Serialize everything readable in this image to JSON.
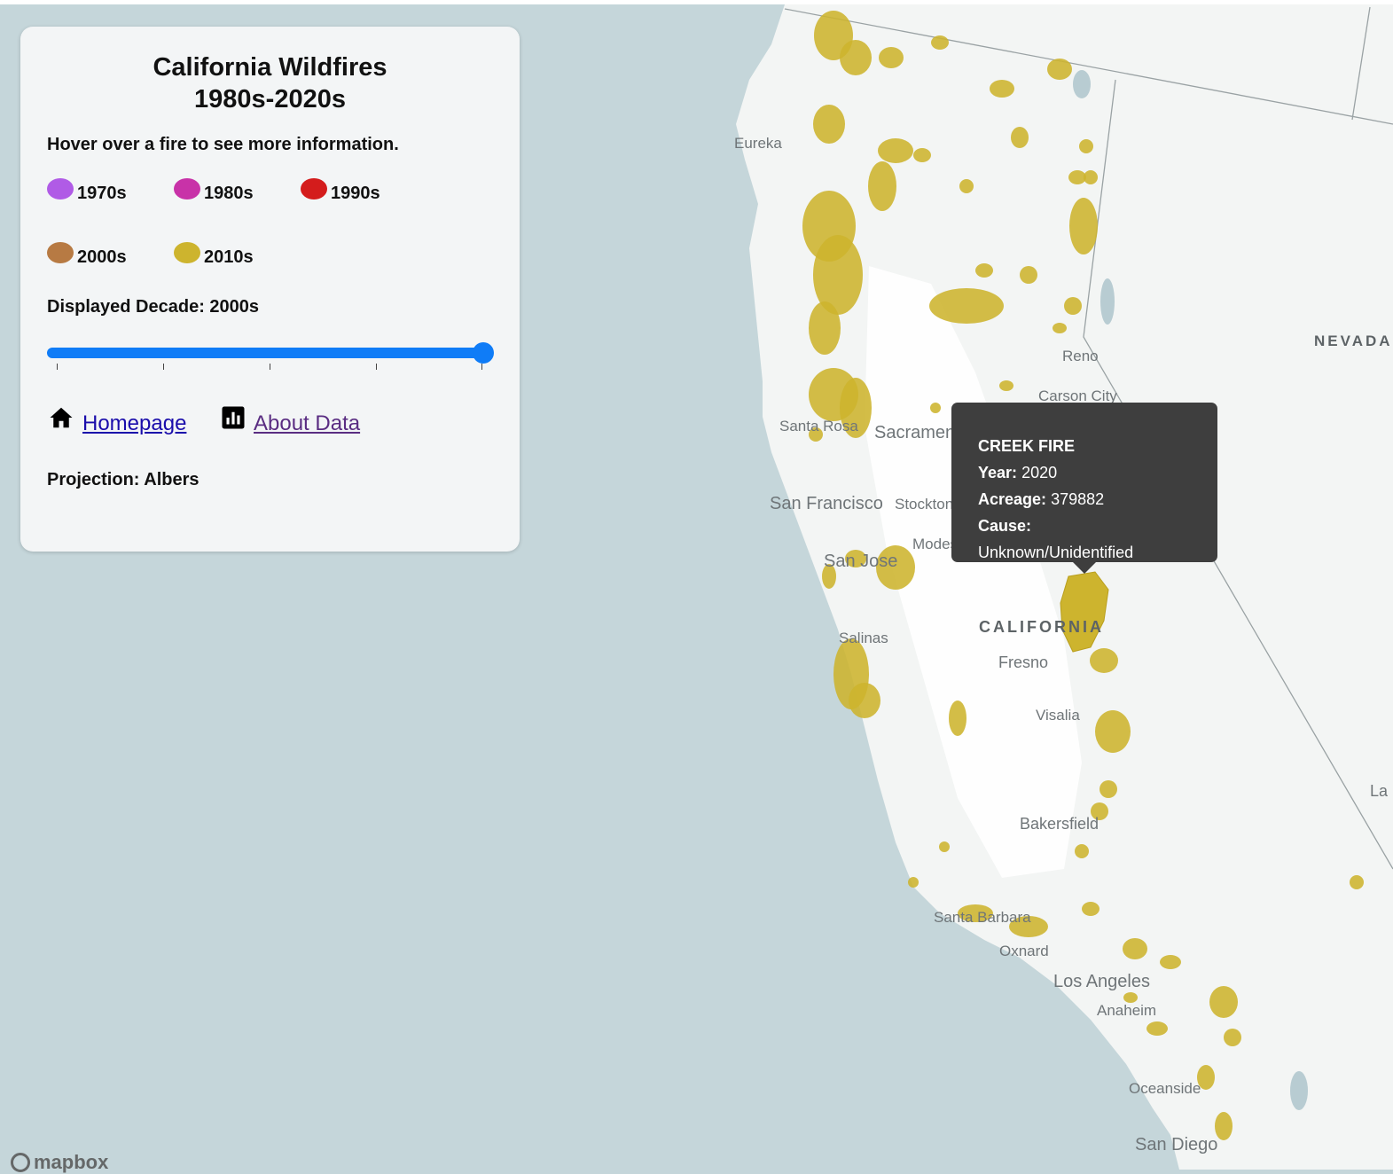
{
  "panel": {
    "title_line1": "California Wildfires",
    "title_line2": "1980s-2020s",
    "instruction": "Hover over a fire to see more information.",
    "legend": [
      {
        "label": "1970s",
        "color": "#b05be6"
      },
      {
        "label": "1980s",
        "color": "#c832a8"
      },
      {
        "label": "1990s",
        "color": "#d41c1c"
      },
      {
        "label": "2000s",
        "color": "#b77a43"
      },
      {
        "label": "2010s",
        "color": "#cdb42e"
      }
    ],
    "displayed_decade": "Displayed Decade: 2000s",
    "slider": {
      "ticks": 5,
      "value_fraction": 1.0
    },
    "links": {
      "homepage": "Homepage",
      "about": "About Data"
    },
    "projection": "Projection: Albers"
  },
  "tooltip": {
    "name": "CREEK FIRE",
    "year_label": "Year:",
    "year": "2020",
    "acreage_label": "Acreage:",
    "acreage": "379882",
    "cause_label": "Cause:",
    "cause": "Unknown/Unidentified"
  },
  "map": {
    "fire_color": "#cdb42e",
    "labels": {
      "eureka": "Eureka",
      "reno": "Reno",
      "carson": "Carson City",
      "nevada": "NEVADA",
      "santarosa": "Santa Rosa",
      "sacramento": "Sacramento",
      "sanfrancisco": "San Francisco",
      "stockton": "Stockton",
      "modesto": "Modesto",
      "sanjose": "San Jose",
      "california": "CALIFORNIA",
      "salinas": "Salinas",
      "fresno": "Fresno",
      "visalia": "Visalia",
      "bakersfield": "Bakersfield",
      "santabarbara": "Santa Barbara",
      "oxnard": "Oxnard",
      "losangeles": "Los Angeles",
      "anaheim": "Anaheim",
      "oceanside": "Oceanside",
      "sandiego": "San Diego",
      "la": "La"
    },
    "attribution": "mapbox"
  }
}
